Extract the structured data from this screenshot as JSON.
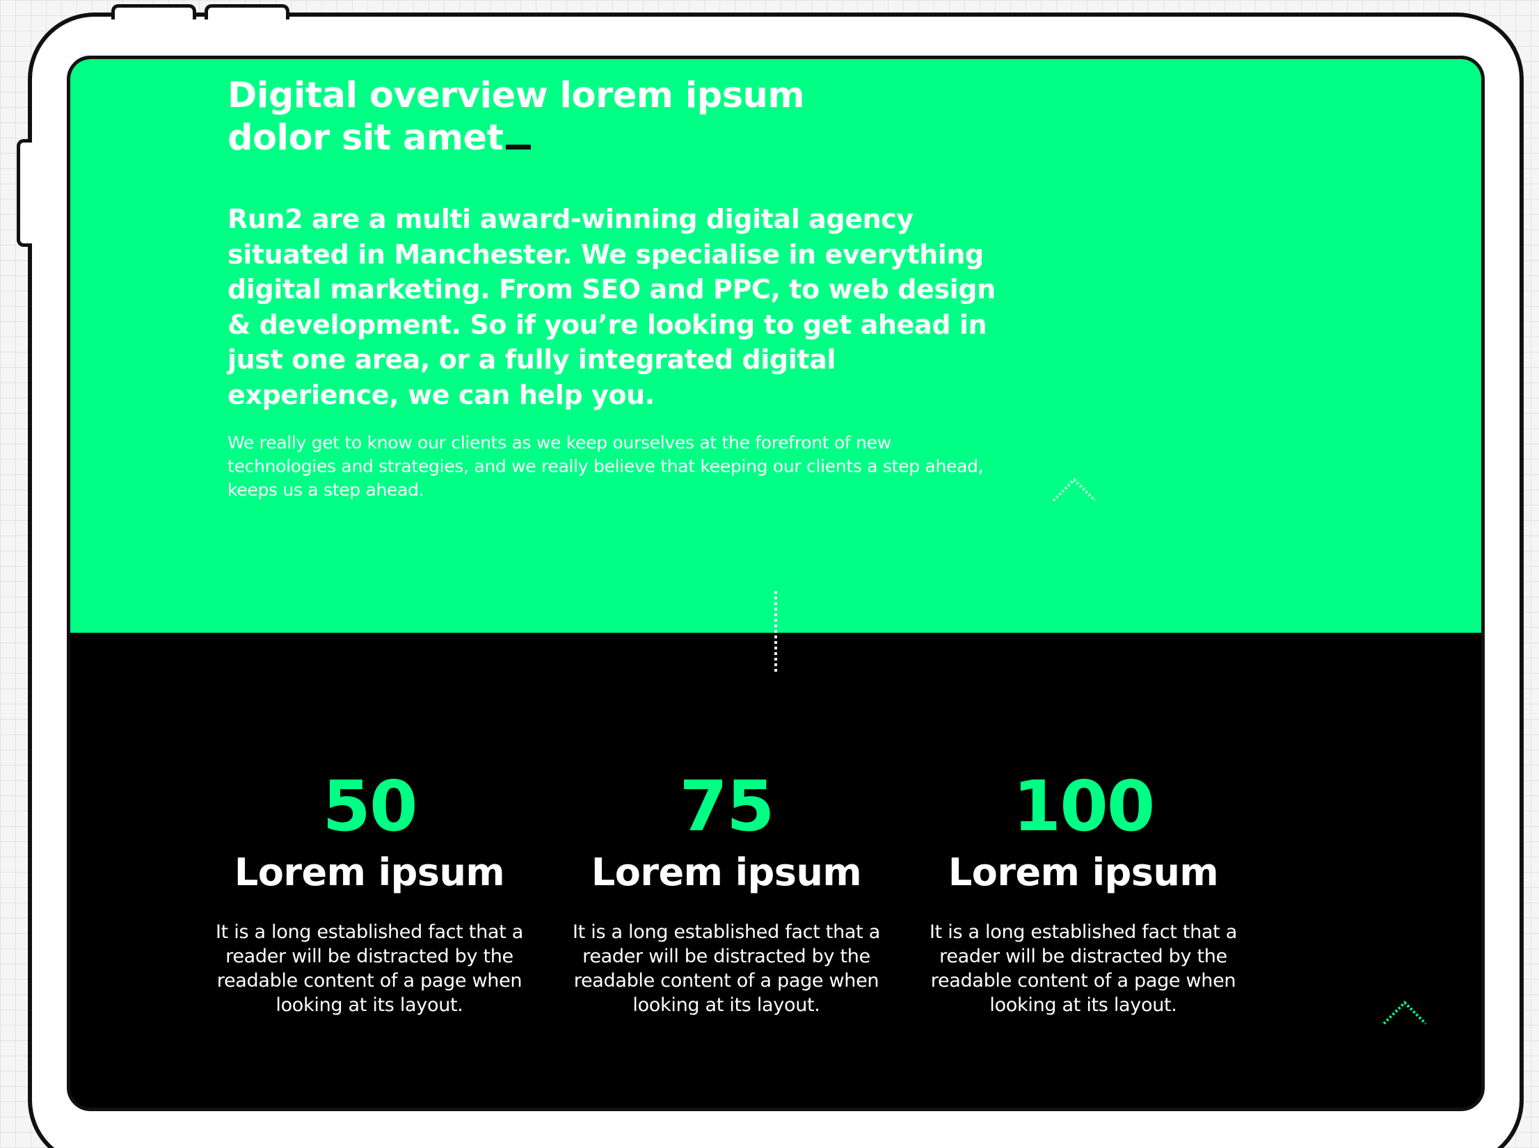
{
  "hero": {
    "heading_line1": "Digital overview lorem ipsum",
    "heading_line2": "dolor sit amet",
    "intro": "Run2 are a multi award-winning digital agency situated in Manchester. We specialise in everything digital marketing. From SEO and PPC, to web design & development. So if you’re looking to get ahead in just one area, or a fully integrated digital experience, we can help you.",
    "body": "We really get to know our clients as we keep ourselves at the forefront of new technologies and strategies, and we really believe that keeping our clients a step ahead, keeps us a step ahead."
  },
  "stats": [
    {
      "number": "50",
      "title": "Lorem ipsum",
      "description": "It is a long established fact that a reader will be distracted by the readable content of a page when looking at its layout."
    },
    {
      "number": "75",
      "title": "Lorem ipsum",
      "description": "It is a long established fact that a reader will be distracted by the readable content of a page when looking at its layout."
    },
    {
      "number": "100",
      "title": "Lorem ipsum",
      "description": "It is a long established fact that a reader will be distracted by the readable content of a page when looking at its layout."
    }
  ],
  "icons": {
    "hero_scroll": "chevron-up-icon",
    "stats_scroll": "chevron-up-icon"
  },
  "colors": {
    "accent_green": "#00ff85",
    "dark_background": "#000000",
    "text_white": "#ffffff"
  }
}
